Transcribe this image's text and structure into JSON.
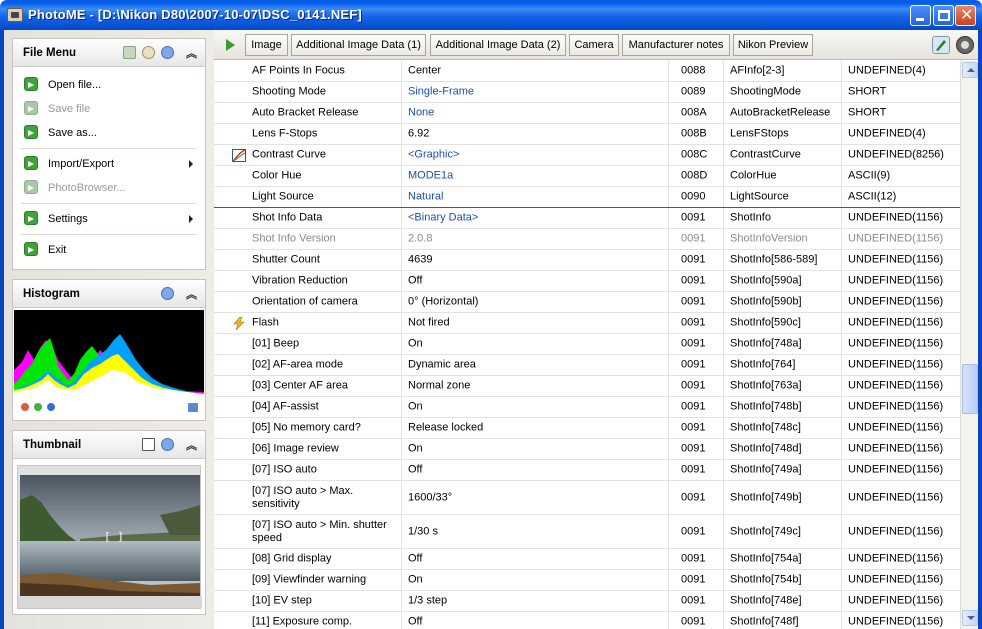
{
  "window": {
    "title": "PhotoME - [D:\\Nikon D80\\2007-10-07\\DSC_0141.NEF]"
  },
  "file_menu": {
    "title": "File Menu",
    "items": [
      {
        "label": "Open file...",
        "icon": "green-arrow-icon",
        "enabled": true
      },
      {
        "label": "Save file",
        "icon": "green-arrow-icon",
        "enabled": false
      },
      {
        "label": "Save as...",
        "icon": "green-arrow-icon",
        "enabled": true
      },
      {
        "label": "Import/Export",
        "icon": "green-arrow-icon",
        "enabled": true,
        "submenu": true
      },
      {
        "label": "PhotoBrowser...",
        "icon": "green-arrow-icon",
        "enabled": false
      },
      {
        "label": "Settings",
        "icon": "green-arrow-icon",
        "enabled": true,
        "submenu": true
      },
      {
        "label": "Exit",
        "icon": "green-arrow-icon",
        "enabled": true
      }
    ]
  },
  "histogram": {
    "title": "Histogram"
  },
  "thumbnail": {
    "title": "Thumbnail",
    "focus_marker": "[ ]"
  },
  "tabs": [
    {
      "label": "Image"
    },
    {
      "label": "Additional Image Data (1)"
    },
    {
      "label": "Additional Image Data (2)"
    },
    {
      "label": "Camera"
    },
    {
      "label": "Manufacturer notes"
    },
    {
      "label": "Nikon Preview"
    }
  ],
  "rows": [
    {
      "name": "AF Points In Focus",
      "value": "Center",
      "tag": "0088",
      "field": "AFInfo[2-3]",
      "type": "UNDEFINED(4)"
    },
    {
      "name": "Shooting Mode",
      "value": "Single-Frame",
      "tag": "0089",
      "field": "ShootingMode",
      "type": "SHORT",
      "style": "blue"
    },
    {
      "name": "Auto Bracket Release",
      "value": "None",
      "tag": "008A",
      "field": "AutoBracketRelease",
      "type": "SHORT",
      "style": "blue"
    },
    {
      "name": "Lens F-Stops",
      "value": "6.92",
      "tag": "008B",
      "field": "LensFStops",
      "type": "UNDEFINED(4)"
    },
    {
      "name": "Contrast Curve",
      "value": "<Graphic>",
      "tag": "008C",
      "field": "ContrastCurve",
      "type": "UNDEFINED(8256)",
      "style": "blue",
      "icon": "curve-icon"
    },
    {
      "name": "Color Hue",
      "value": "MODE1a",
      "tag": "008D",
      "field": "ColorHue",
      "type": "ASCII(9)",
      "style": "blue"
    },
    {
      "name": "Light Source",
      "value": "Natural",
      "tag": "0090",
      "field": "LightSource",
      "type": "ASCII(12)",
      "style": "blue",
      "separator": true
    },
    {
      "name": "Shot Info Data",
      "value": "<Binary Data>",
      "tag": "0091",
      "field": "ShotInfo",
      "type": "UNDEFINED(1156)",
      "style": "blue"
    },
    {
      "name": "Shot Info Version",
      "value": "2.0.8",
      "tag": "0091",
      "field": "ShotInfoVersion",
      "type": "UNDEFINED(1156)",
      "style": "gray"
    },
    {
      "name": "Shutter Count",
      "value": "4639",
      "tag": "0091",
      "field": "ShotInfo[586-589]",
      "type": "UNDEFINED(1156)"
    },
    {
      "name": "Vibration Reduction",
      "value": "Off",
      "tag": "0091",
      "field": "ShotInfo[590a]",
      "type": "UNDEFINED(1156)"
    },
    {
      "name": "Orientation of camera",
      "value": "0° (Horizontal)",
      "tag": "0091",
      "field": "ShotInfo[590b]",
      "type": "UNDEFINED(1156)"
    },
    {
      "name": "Flash",
      "value": "Not fired",
      "tag": "0091",
      "field": "ShotInfo[590c]",
      "type": "UNDEFINED(1156)",
      "icon": "flash-icon"
    },
    {
      "name": "[01] Beep",
      "value": "On",
      "tag": "0091",
      "field": "ShotInfo[748a]",
      "type": "UNDEFINED(1156)"
    },
    {
      "name": "[02] AF-area mode",
      "value": "Dynamic area",
      "tag": "0091",
      "field": "ShotInfo[764]",
      "type": "UNDEFINED(1156)"
    },
    {
      "name": "[03] Center AF area",
      "value": "Normal zone",
      "tag": "0091",
      "field": "ShotInfo[763a]",
      "type": "UNDEFINED(1156)"
    },
    {
      "name": "[04] AF-assist",
      "value": "On",
      "tag": "0091",
      "field": "ShotInfo[748b]",
      "type": "UNDEFINED(1156)"
    },
    {
      "name": "[05] No memory card?",
      "value": "Release locked",
      "tag": "0091",
      "field": "ShotInfo[748c]",
      "type": "UNDEFINED(1156)"
    },
    {
      "name": "[06] Image review",
      "value": "On",
      "tag": "0091",
      "field": "ShotInfo[748d]",
      "type": "UNDEFINED(1156)"
    },
    {
      "name": "[07] ISO auto",
      "value": "Off",
      "tag": "0091",
      "field": "ShotInfo[749a]",
      "type": "UNDEFINED(1156)"
    },
    {
      "name": "[07] ISO auto > Max. sensitivity",
      "value": "1600/33°",
      "tag": "0091",
      "field": "ShotInfo[749b]",
      "type": "UNDEFINED(1156)",
      "tall": true
    },
    {
      "name": "[07] ISO auto > Min. shutter speed",
      "value": "1/30 s",
      "tag": "0091",
      "field": "ShotInfo[749c]",
      "type": "UNDEFINED(1156)",
      "tall": true
    },
    {
      "name": "[08] Grid display",
      "value": "Off",
      "tag": "0091",
      "field": "ShotInfo[754a]",
      "type": "UNDEFINED(1156)"
    },
    {
      "name": "[09] Viewfinder warning",
      "value": "On",
      "tag": "0091",
      "field": "ShotInfo[754b]",
      "type": "UNDEFINED(1156)"
    },
    {
      "name": "[10] EV step",
      "value": "1/3 step",
      "tag": "0091",
      "field": "ShotInfo[748e]",
      "type": "UNDEFINED(1156)"
    },
    {
      "name": "[11] Exposure comp.",
      "value": "Off",
      "tag": "0091",
      "field": "ShotInfo[748f]",
      "type": "UNDEFINED(1156)"
    }
  ],
  "colors": {
    "title_bar": "#0058ee",
    "value_blue": "#1d4fa8",
    "value_gray": "#8a8a8a",
    "menu_icon_green": "#3fa33a"
  }
}
